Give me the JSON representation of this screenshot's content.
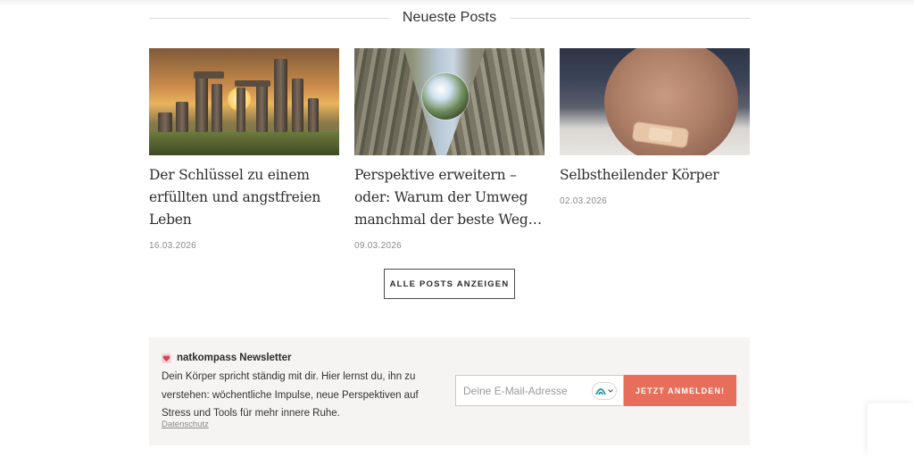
{
  "section": {
    "title": "Neueste Posts"
  },
  "posts": [
    {
      "title": "Der Schlüssel zu einem erfüllten und angstfreien Leben",
      "date": "16.03.2026",
      "image_icon": "stonehenge-sunset-image"
    },
    {
      "title": "Perspektive erweitern – oder: Warum der Umweg manchmal der beste Weg…",
      "date": "09.03.2026",
      "image_icon": "glass-ball-between-trees-image"
    },
    {
      "title": "Selbstheilender Körper",
      "date": "02.03.2026",
      "image_icon": "knee-plaster-image"
    }
  ],
  "all_posts_button": "ALLE POSTS ANZEIGEN",
  "newsletter": {
    "emoji_icon": "heart-icon",
    "title": "natkompass Newsletter",
    "text": "Dein Körper spricht ständig mit dir. Hier lernst du, ihn zu verstehen: wöchentliche Impulse, neue Perspektiven auf Stress und Tools für mehr innere Ruhe.",
    "privacy_link": "Datenschutz",
    "email_placeholder": "Deine E-Mail-Adresse",
    "submit_label": "JETZT ANMELDEN!",
    "accent_color": "#e86e5c"
  }
}
